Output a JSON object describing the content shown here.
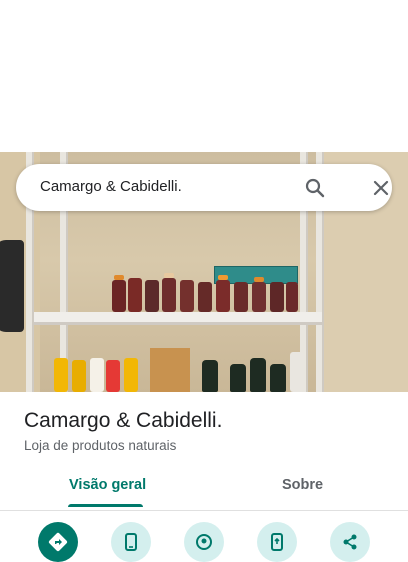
{
  "search": {
    "query": "Camargo & Cabidelli.",
    "search_icon": "search-icon",
    "close_icon": "close-icon"
  },
  "place": {
    "name": "Camargo & Cabidelli.",
    "category": "Loja de produtos naturais"
  },
  "tabs": [
    {
      "label": "Visão geral",
      "active": true
    },
    {
      "label": "Sobre",
      "active": false
    }
  ],
  "actions": [
    {
      "icon": "directions-icon",
      "style": "primary"
    },
    {
      "icon": "phone-icon",
      "style": "secondary"
    },
    {
      "icon": "nearby-icon",
      "style": "secondary"
    },
    {
      "icon": "send-to-phone-icon",
      "style": "secondary"
    },
    {
      "icon": "share-icon",
      "style": "secondary"
    }
  ],
  "colors": {
    "accent": "#00796b",
    "secondary_button": "#d4efee",
    "text_primary": "#202124",
    "text_secondary": "#5f6368"
  }
}
